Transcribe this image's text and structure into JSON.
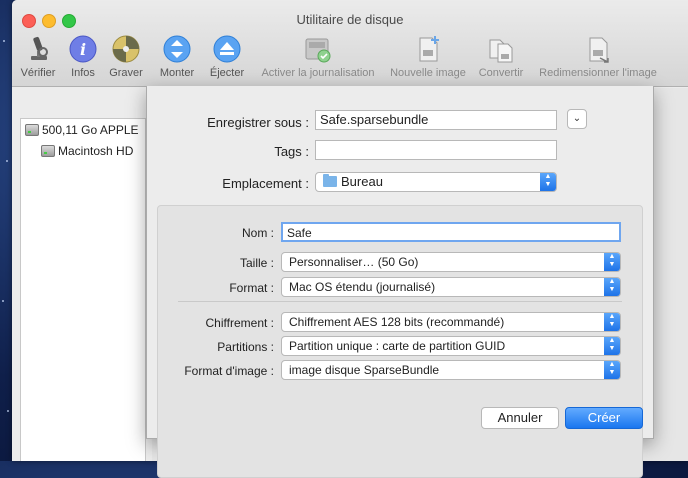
{
  "window": {
    "title": "Utilitaire de disque"
  },
  "toolbar": [
    {
      "key": "verify",
      "label": "Vérifier",
      "icon": "microscope-icon",
      "enabled": true
    },
    {
      "key": "info",
      "label": "Infos",
      "icon": "info-icon",
      "enabled": true
    },
    {
      "key": "burn",
      "label": "Graver",
      "icon": "burn-disc-icon",
      "enabled": true
    },
    {
      "key": "mount",
      "label": "Monter",
      "icon": "mount-icon",
      "enabled": true
    },
    {
      "key": "eject",
      "label": "Éjecter",
      "icon": "eject-icon",
      "enabled": true
    },
    {
      "key": "journal",
      "label": "Activer la journalisation",
      "icon": "journaling-disk-icon",
      "enabled": false
    },
    {
      "key": "new_image",
      "label": "Nouvelle image",
      "icon": "new-image-icon",
      "enabled": false
    },
    {
      "key": "convert",
      "label": "Convertir",
      "icon": "convert-icon",
      "enabled": false
    },
    {
      "key": "resize",
      "label": "Redimensionner l'image",
      "icon": "resize-image-icon",
      "enabled": false
    }
  ],
  "sidebar": {
    "disks": [
      {
        "label": "500,11 Go APPLE"
      },
      {
        "label": "Macintosh HD"
      }
    ]
  },
  "sheet": {
    "save_as": {
      "label": "Enregistrer sous :",
      "value": "Safe.sparsebundle"
    },
    "tags": {
      "label": "Tags :",
      "value": ""
    },
    "location": {
      "label": "Emplacement :",
      "value": "Bureau"
    },
    "name": {
      "label": "Nom :",
      "value": "Safe"
    },
    "size": {
      "label": "Taille :",
      "value": "Personnaliser… (50 Go)"
    },
    "format": {
      "label": "Format :",
      "value": "Mac OS étendu (journalisé)"
    },
    "encryption": {
      "label": "Chiffrement :",
      "value": "Chiffrement AES 128 bits (recommandé)"
    },
    "partitions": {
      "label": "Partitions :",
      "value": "Partition unique : carte de partition GUID"
    },
    "image_format": {
      "label": "Format d'image :",
      "value": "image disque SparseBundle"
    },
    "cancel_label": "Annuler",
    "create_label": "Créer"
  },
  "colors": {
    "accent": "#1a76ef",
    "close": "#fc5f57",
    "minimize": "#fdbc2e",
    "zoom": "#33c748"
  }
}
